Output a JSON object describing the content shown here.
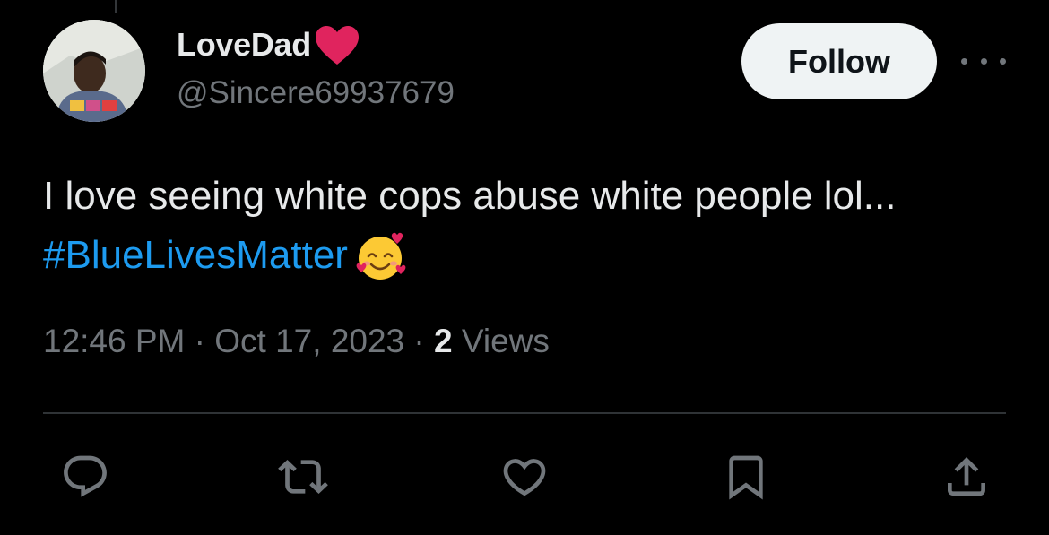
{
  "author": {
    "display_name": "LoveDad",
    "handle": "@Sincere69937679",
    "heart_emoji": "❤️"
  },
  "header": {
    "follow_label": "Follow",
    "more_icon": "ellipsis-icon"
  },
  "tweet": {
    "text": "I love seeing white cops abuse white people lol...",
    "hashtag": "#BlueLivesMatter",
    "emoji": "🥰"
  },
  "meta": {
    "time": "12:46 PM",
    "sep1": " · ",
    "date": "Oct 17, 2023",
    "sep2": " · ",
    "views_count": "2",
    "views_label": " Views"
  },
  "actions": [
    "reply-icon",
    "retweet-icon",
    "like-icon",
    "bookmark-icon",
    "share-icon"
  ],
  "colors": {
    "background": "#000000",
    "text": "#e7e9ea",
    "muted": "#71767b",
    "link": "#1d9bf0",
    "heart": "#e0245e"
  }
}
